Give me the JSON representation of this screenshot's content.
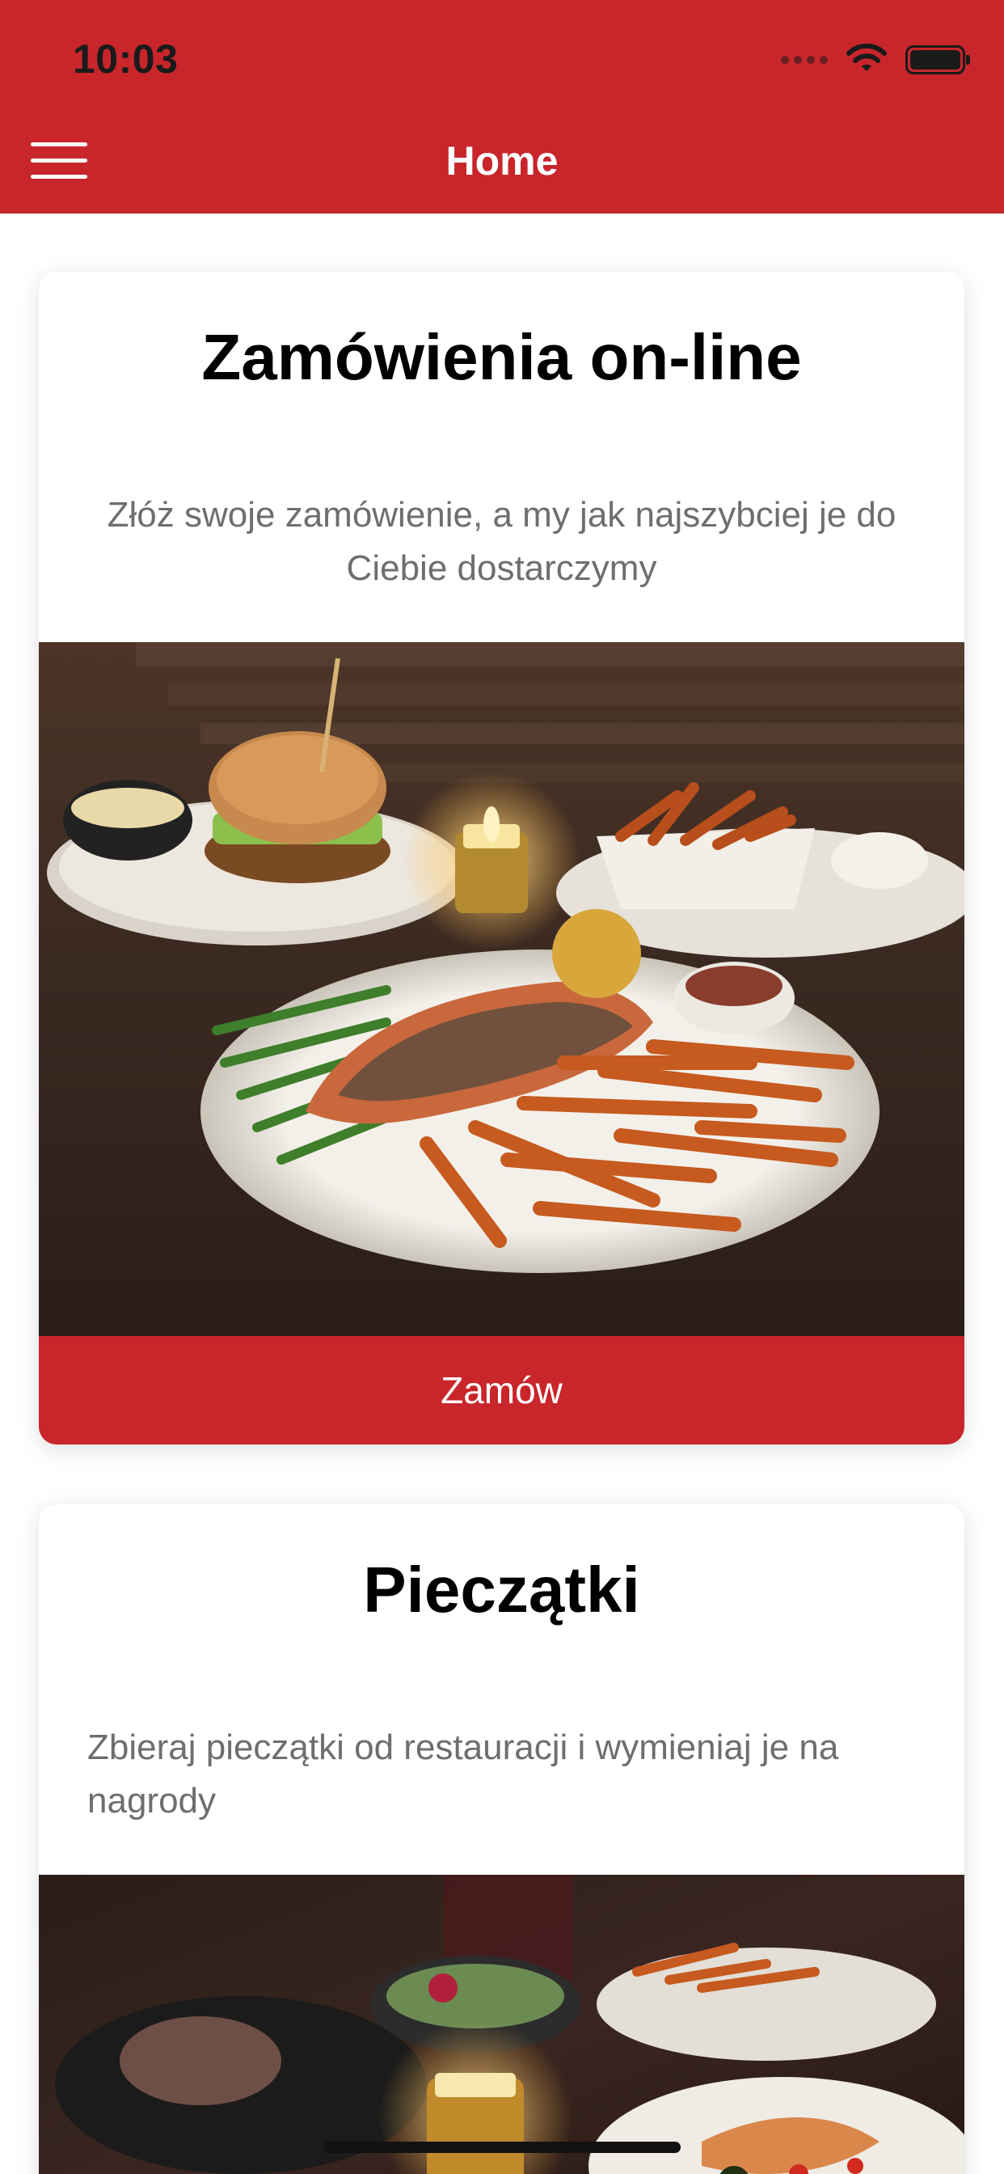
{
  "status_bar": {
    "time": "10:03"
  },
  "nav": {
    "title": "Home",
    "menu_icon": "hamburger-menu-icon"
  },
  "cards": [
    {
      "title": "Zamówienia on-line",
      "description": "Złóż swoje zamówienie, a my jak najszybciej je do Ciebie dostarczymy",
      "image_subject": "food-photo-salmon-fries-burger",
      "button_label": "Zamów"
    },
    {
      "title": "Pieczątki",
      "description": "Zbieraj pieczątki od restauracji i wymieniaj je na nagrody",
      "image_subject": "food-photo-restaurant-table"
    }
  ],
  "colors": {
    "brand": "#c8262b",
    "card_bg": "#ffffff",
    "text_secondary": "#6e6e6e"
  }
}
